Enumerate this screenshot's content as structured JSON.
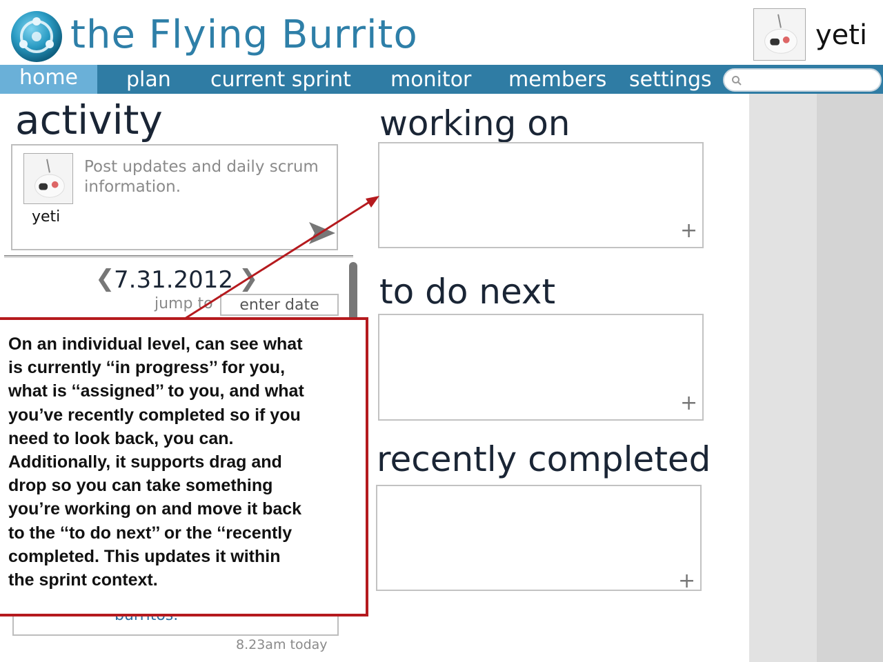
{
  "header": {
    "app_title": "the Flying Burrito",
    "user_name": "yeti"
  },
  "nav": {
    "items": [
      {
        "label": "home",
        "active": true
      },
      {
        "label": "plan"
      },
      {
        "label": "current sprint"
      },
      {
        "label": "monitor"
      },
      {
        "label": "members"
      },
      {
        "label": "settings"
      }
    ],
    "search_placeholder": ""
  },
  "activity": {
    "title": "activity",
    "post": {
      "placeholder": "Post updates and daily scrum information.",
      "user": "yeti"
    },
    "date_nav": {
      "prev": "❮",
      "date": "7.31.2012",
      "next": "❯",
      "jump_label": "jump to",
      "date_placeholder": "enter date"
    },
    "feed": {
      "text": "burritos.",
      "time": "8.23am today"
    }
  },
  "sections": {
    "working_on": {
      "title": "working on",
      "add": "+"
    },
    "to_do_next": {
      "title": "to do next",
      "add": "+"
    },
    "recently_completed": {
      "title": "recently completed",
      "add": "+"
    }
  },
  "annotation": {
    "text": "On an individual level, can see what is currently ‘‘in progress’’ for you, what is ‘‘assigned’’ to you, and what you’ve recently completed so if you need to look back, you can. Additionally, it supports drag and drop so you can take something you’re working on and move it back to the ‘‘to do next’’ or the ‘‘recently completed. This updates it within the sprint context.",
    "lines": [
      "On an individual level, can see what",
      "is currently ‘‘in progress’’ for you,",
      "what is ‘‘assigned’’ to you, and what",
      "you’ve recently completed so if you",
      "need to look back, you can.",
      "Additionally, it supports drag and",
      "drop so you can take something",
      "you’re working on and move it back",
      "to the ‘‘to do next’’ or the ‘‘recently",
      "completed. This updates it within",
      "the sprint context."
    ],
    "color": "#b51a1e"
  },
  "colors": {
    "brand": "#2e7fa8",
    "nav_bar": "#2f7ca4",
    "nav_active": "#6ab0d8"
  }
}
